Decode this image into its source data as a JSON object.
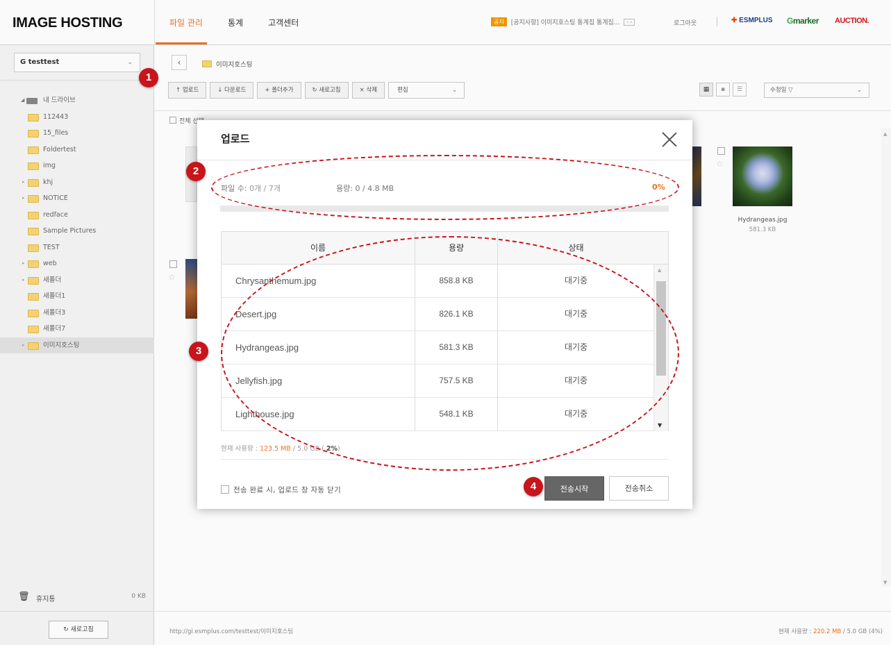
{
  "header": {
    "logo": "IMAGE HOSTING",
    "nav": [
      "파일 관리",
      "통계",
      "고객센터"
    ],
    "notice_badge": "공지",
    "notice_text": "[공지사항] 이미지호스팅 통계집 통계집...",
    "notice_arrows": "‹ ›",
    "logout": "로그아웃",
    "brands": {
      "esmplus": "ESMPLUS",
      "gmarket": "marker",
      "gmarket_g": "G",
      "auction": "AUCTION."
    }
  },
  "sidebar": {
    "account": "G testtest",
    "tree": {
      "root": "내 드라이브",
      "folders": [
        "112443",
        "15_files",
        "Foldertest",
        "img",
        "khj",
        "NOTICE",
        "redface",
        "Sample Pictures",
        "TEST",
        "web",
        "새폴더",
        "새폴더1",
        "새폴더3",
        "새폴더7",
        "이미지호스팅"
      ]
    },
    "trash_label": "휴지통",
    "trash_size": "0 KB",
    "refresh_button": "새로고침"
  },
  "main": {
    "breadcrumb": "이미지호스팅",
    "toolbar": [
      "업로드",
      "다운로드",
      "폴더추가",
      "새로고침",
      "삭제"
    ],
    "edit_select": "편집",
    "sort_select": "수정일 ▽",
    "select_all": "전체 선택",
    "thumbs": [
      {
        "name": "Hydrangeas.jpg",
        "size": "581.3 KB"
      }
    ],
    "footer_url": "http://gi.esmplus.com/testtest/이미지호스팅",
    "footer_usage_prefix": "현재 사용량 : ",
    "footer_usage_used": "220.2 MB",
    "footer_usage_suffix": " / 5.0 GB (4%)"
  },
  "modal": {
    "title": "업로드",
    "file_count_label": "파일 수: ",
    "file_count_value": "0개 / 7개",
    "capacity_label": "용량: ",
    "capacity_value": "0 / 4.8 MB",
    "percent": "0%",
    "progress": 0,
    "columns": [
      "이름",
      "용량",
      "상태"
    ],
    "files": [
      {
        "name": "Chrysanthemum.jpg",
        "size": "858.8 KB",
        "status": "대기중"
      },
      {
        "name": "Desert.jpg",
        "size": "826.1 KB",
        "status": "대기중"
      },
      {
        "name": "Hydrangeas.jpg",
        "size": "581.3 KB",
        "status": "대기중"
      },
      {
        "name": "Jellyfish.jpg",
        "size": "757.5 KB",
        "status": "대기중"
      },
      {
        "name": "Lighthouse.jpg",
        "size": "548.1 KB",
        "status": "대기중"
      }
    ],
    "usage_prefix": "현재 사용량 : ",
    "usage_used": "123.5 MB",
    "usage_mid": " / 5.0 GB ( ",
    "usage_pct": "2%",
    "usage_end": ")",
    "auto_close": "전송 완료 시, 업로드 창 자동 닫기",
    "start_button": "전송시작",
    "cancel_button": "전송취소"
  },
  "callouts": [
    "1",
    "2",
    "3",
    "4"
  ],
  "colors": {
    "accent": "#f37021",
    "callout": "#c8141b"
  }
}
